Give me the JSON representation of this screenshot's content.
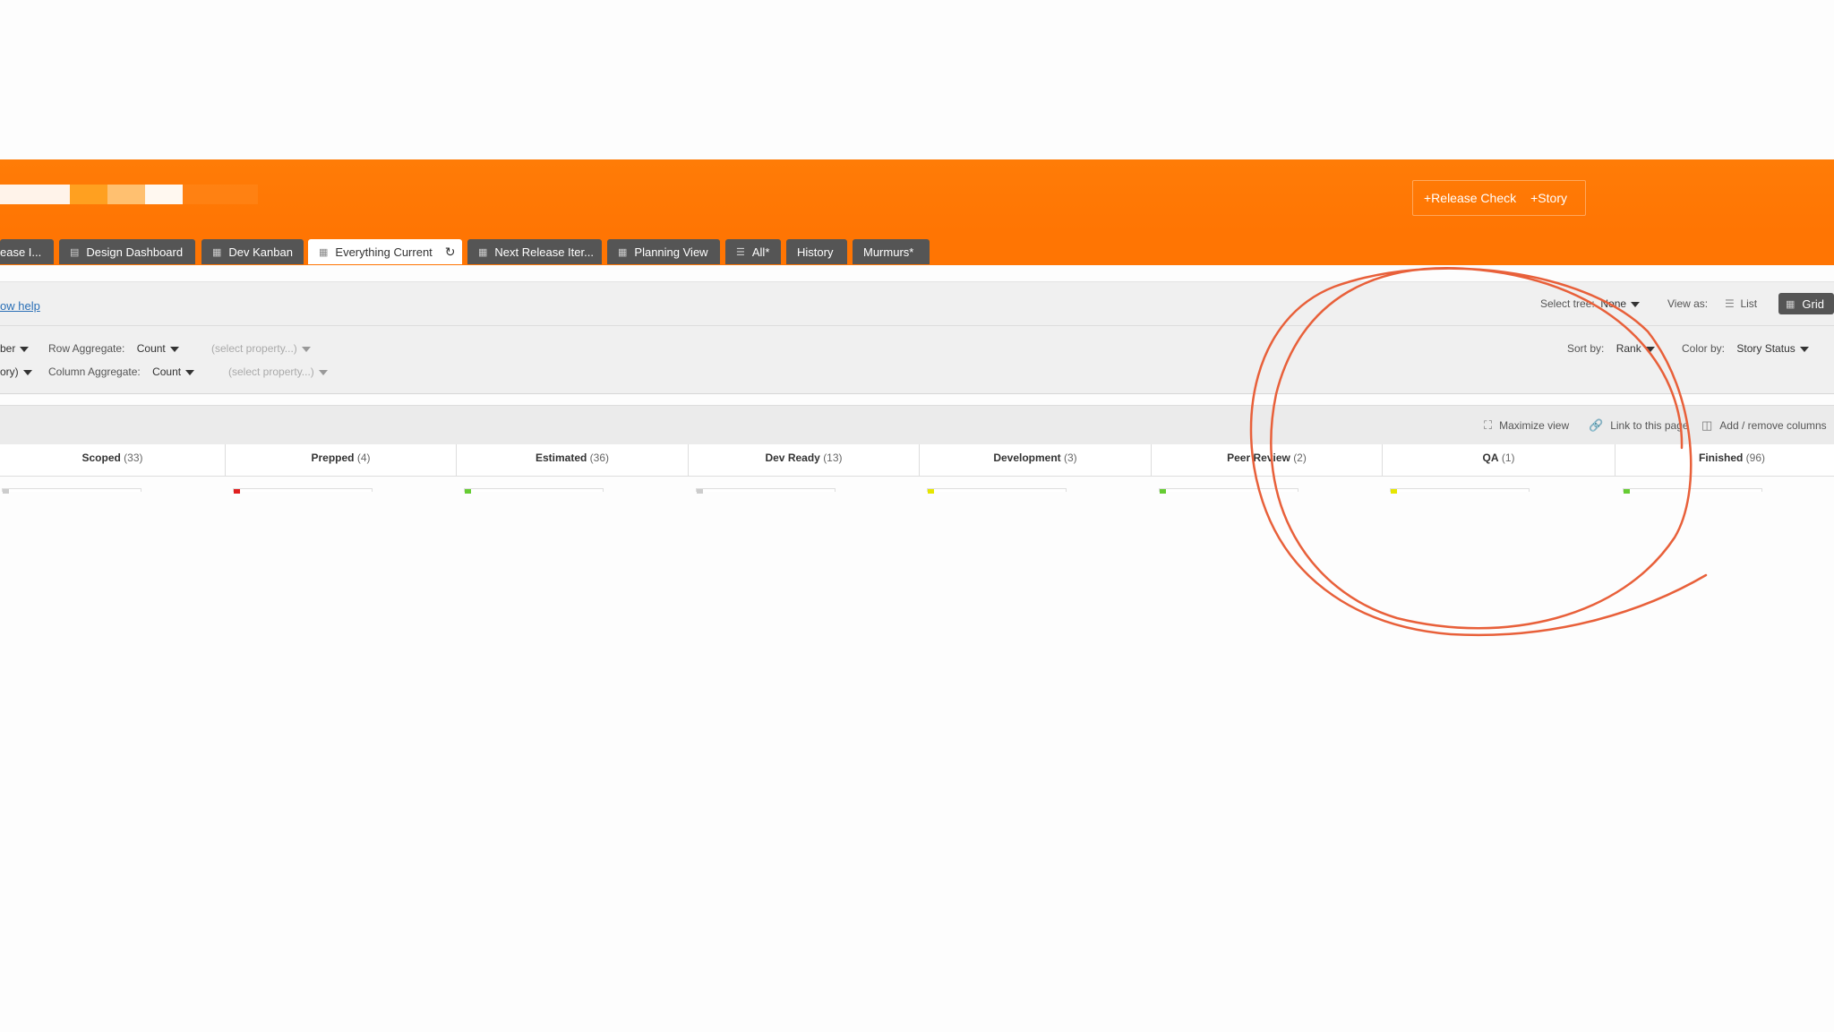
{
  "header": {
    "create_links": [
      "+Release Check",
      "+Story"
    ]
  },
  "tabs": [
    {
      "label": "ease I...",
      "icon": "none",
      "active": false
    },
    {
      "label": "Design Dashboard",
      "icon": "dashboard-icon",
      "active": false
    },
    {
      "label": "Dev Kanban",
      "icon": "grid-icon",
      "active": false
    },
    {
      "label": "Everything Current",
      "icon": "grid-icon",
      "active": true,
      "extra": "refresh-icon"
    },
    {
      "label": "Next Release Iter...",
      "icon": "grid-icon",
      "active": false
    },
    {
      "label": "Planning View",
      "icon": "grid-icon",
      "active": false
    },
    {
      "label": "All*",
      "icon": "list-icon",
      "active": false
    },
    {
      "label": "History",
      "icon": "none",
      "active": false
    },
    {
      "label": "Murmurs*",
      "icon": "none",
      "active": false
    }
  ],
  "toolbar": {
    "help_link": "ow help",
    "select_tree_label": "Select tree:",
    "select_tree_value": "None",
    "view_as_label": "View as:",
    "view_list": "List",
    "view_grid": "Grid"
  },
  "aggregates": {
    "row1_prefix": "ber",
    "row_aggregate_label": "Row Aggregate:",
    "row_aggregate_value": "Count",
    "row_property_placeholder": "(select property...)",
    "row2_prefix": "ory)",
    "column_aggregate_label": "Column Aggregate:",
    "column_aggregate_value": "Count",
    "column_property_placeholder": "(select property...)",
    "sort_by_label": "Sort by:",
    "sort_by_value": "Rank",
    "color_by_label": "Color by:",
    "color_by_value": "Story Status"
  },
  "view_tools": {
    "maximize": "Maximize view",
    "link": "Link to this page",
    "columns": "Add / remove columns"
  },
  "columns": [
    {
      "name": "Scoped",
      "count": "(33)",
      "card_color": "#cccccc"
    },
    {
      "name": "Prepped",
      "count": "(4)",
      "card_color": "#e02020"
    },
    {
      "name": "Estimated",
      "count": "(36)",
      "card_color": "#66cc33"
    },
    {
      "name": "Dev Ready",
      "count": "(13)",
      "card_color": "#cccccc"
    },
    {
      "name": "Development",
      "count": "(3)",
      "card_color": "#e6e600"
    },
    {
      "name": "Peer Review",
      "count": "(2)",
      "card_color": "#66cc33"
    },
    {
      "name": "QA",
      "count": "(1)",
      "card_color": "#e6e600"
    },
    {
      "name": "Finished",
      "count": "(96)",
      "card_color": "#66cc33"
    }
  ],
  "colors": {
    "brand_orange": "#ff7503",
    "tab_dark": "#555555",
    "annotation": "#e8603a"
  }
}
